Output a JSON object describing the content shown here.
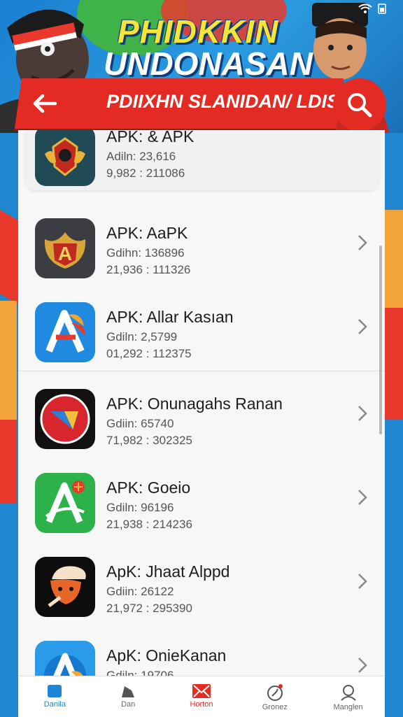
{
  "header": {
    "title_line1": "PHIDKKIN",
    "title_line2": "UNDONASAN",
    "subtitle": "PDIIXHN SLANIDAN/ LDIS",
    "back_icon": "arrow-left-icon",
    "search_icon": "search-icon"
  },
  "apps": [
    {
      "name": "APK: & APK",
      "meta1": "Adiln: 23,616",
      "meta2": "9,982 : 211086",
      "icon": "emblem-eagle-icon"
    },
    {
      "name": "APK: AaPK",
      "meta1": "Gdihn: 136896",
      "meta2": "21,936 : 111326",
      "icon": "emblem-a-shield-icon"
    },
    {
      "name": "APK: Allar Kasıan",
      "meta1": "Gdiln: 2,5799",
      "meta2": "01,292 : 112375",
      "icon": "colorful-a-icon"
    },
    {
      "name": "APK: Onunagahs Ranan",
      "meta1": "Gdiin: 65740",
      "meta2": "71,982 : 302325",
      "icon": "red-circle-icon"
    },
    {
      "name": "APK: Goeio",
      "meta1": "Gdiln: 96196",
      "meta2": "21,938 : 214236",
      "icon": "green-a-icon"
    },
    {
      "name": "ApK: Jhaat Alppd",
      "meta1": "Gdiin: 26122",
      "meta2": "21,972 : 295390",
      "icon": "fox-cap-icon"
    },
    {
      "name": "ApK: OnieKanan",
      "meta1": "Gdiln: 19706",
      "meta2": "",
      "icon": "blue-a-icon"
    }
  ],
  "bottom_nav": [
    {
      "label": "Danila",
      "icon": "home-icon"
    },
    {
      "label": "Dan",
      "icon": "apps-icon"
    },
    {
      "label": "Horton",
      "icon": "mail-icon"
    },
    {
      "label": "Gronez",
      "icon": "compass-icon"
    },
    {
      "label": "Manglen",
      "icon": "profile-icon"
    }
  ],
  "colors": {
    "accent_red": "#e32b24",
    "accent_blue": "#1d84d6",
    "title_yellow": "#f7e43a"
  }
}
